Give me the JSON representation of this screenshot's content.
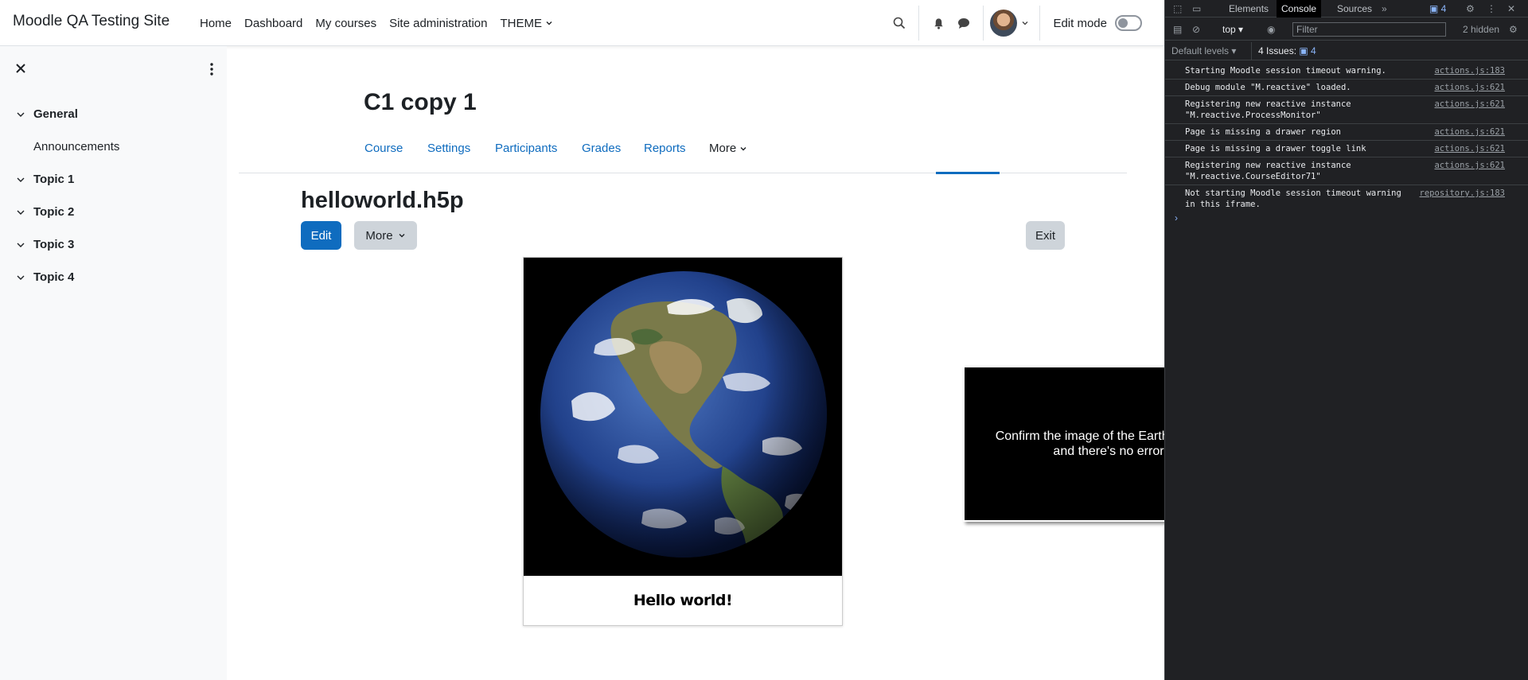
{
  "site": {
    "brand": "Moodle QA Testing Site"
  },
  "primary_nav": [
    {
      "label": "Home"
    },
    {
      "label": "Dashboard"
    },
    {
      "label": "My courses"
    },
    {
      "label": "Site administration"
    },
    {
      "label": "THEME"
    }
  ],
  "header": {
    "edit_mode_label": "Edit mode",
    "edit_mode_on": false
  },
  "drawer": {
    "sections": [
      {
        "label": "General",
        "items": [
          "Announcements"
        ]
      },
      {
        "label": "Topic 1",
        "items": []
      },
      {
        "label": "Topic 2",
        "items": []
      },
      {
        "label": "Topic 3",
        "items": []
      },
      {
        "label": "Topic 4",
        "items": []
      }
    ]
  },
  "course": {
    "title": "C1 copy 1",
    "tabs": [
      "Course",
      "Settings",
      "Participants",
      "Grades",
      "Reports",
      "More"
    ],
    "active_tab": "More"
  },
  "activity": {
    "title": "helloworld.h5p",
    "edit_label": "Edit",
    "more_label": "More",
    "exit_label": "Exit",
    "h5p_caption": "Hello world!"
  },
  "note": {
    "text": "Confirm the image of the Earth is shown and there's no error"
  },
  "colors": {
    "primary": "#0f6cbf",
    "drawer_bg": "#f8f9fa",
    "devtools_bg": "#202124"
  },
  "devtools": {
    "tabs": [
      "Elements",
      "Console",
      "Sources"
    ],
    "active_tab": "Console",
    "issues_badge": "4",
    "context": "top",
    "filter_placeholder": "Filter",
    "hidden_count": "2 hidden",
    "levels_label": "Default levels",
    "issues_label": "4 Issues:",
    "issues_count": "4",
    "logs": [
      {
        "msg": "Starting Moodle session timeout warning.",
        "src": "actions.js:183"
      },
      {
        "msg": "Debug module \"M.reactive\" loaded.",
        "src": "actions.js:621"
      },
      {
        "msg": "Registering new reactive instance \"M.reactive.ProcessMonitor\"",
        "src": "actions.js:621"
      },
      {
        "msg": "Page is missing a drawer region",
        "src": "actions.js:621"
      },
      {
        "msg": "Page is missing a drawer toggle link",
        "src": "actions.js:621"
      },
      {
        "msg": "Registering new reactive instance \"M.reactive.CourseEditor71\"",
        "src": "actions.js:621"
      },
      {
        "msg": "Not starting Moodle session timeout warning in this iframe.",
        "src": "repository.js:183"
      }
    ]
  }
}
